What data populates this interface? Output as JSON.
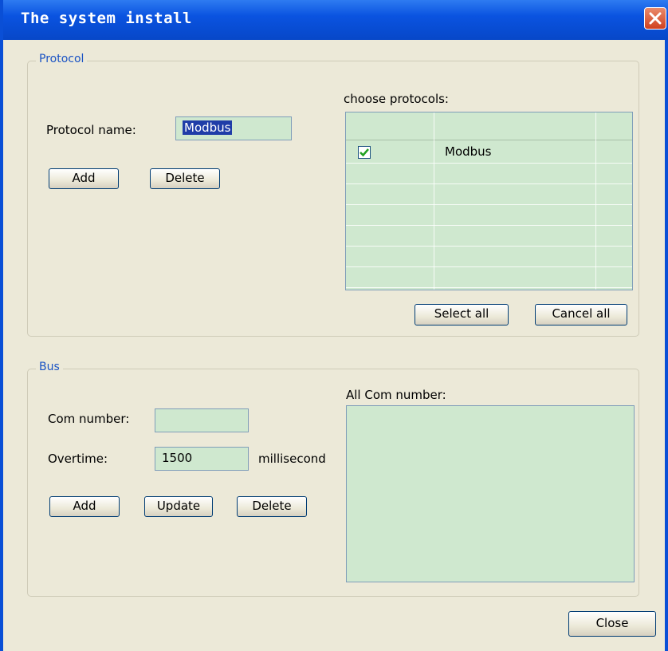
{
  "window": {
    "title": "The system install",
    "close_icon": "close-icon"
  },
  "protocol": {
    "legend": "Protocol",
    "name_label": "Protocol name:",
    "name_value": "Modbus",
    "add_label": "Add",
    "delete_label": "Delete",
    "choose_label": "choose protocols:",
    "rows": [
      {
        "checked": true,
        "name": "Modbus"
      }
    ],
    "select_all_label": "Select all",
    "cancel_all_label": "Cancel all"
  },
  "bus": {
    "legend": "Bus",
    "com_label": "Com number:",
    "com_value": "",
    "overtime_label": "Overtime:",
    "overtime_value": "1500",
    "overtime_unit": "millisecond",
    "add_label": "Add",
    "update_label": "Update",
    "delete_label": "Delete",
    "all_com_label": "All Com number:"
  },
  "footer": {
    "close_label": "Close"
  },
  "colors": {
    "titlebar": "#0a53e0",
    "legend_text": "#1a53c4",
    "field_bg": "#cfe8cf",
    "dialog_bg": "#ece9d8"
  }
}
